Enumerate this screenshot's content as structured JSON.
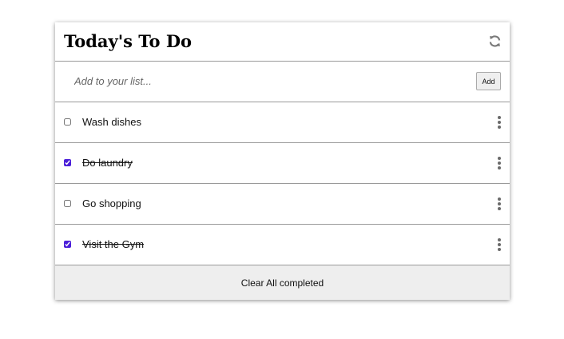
{
  "header": {
    "title": "Today's To Do",
    "refresh_icon": "refresh-icon"
  },
  "add": {
    "placeholder": "Add to your list...",
    "button_label": "Add"
  },
  "items": [
    {
      "label": "Wash dishes",
      "completed": false
    },
    {
      "label": "Do laundry",
      "completed": true
    },
    {
      "label": "Go shopping",
      "completed": false
    },
    {
      "label": "Visit the Gym",
      "completed": true
    }
  ],
  "footer": {
    "clear_label": "Clear All completed"
  },
  "colors": {
    "check_accent": "#4b1fd9",
    "footer_bg": "#eeeeee",
    "divider": "#9a9a9a"
  }
}
